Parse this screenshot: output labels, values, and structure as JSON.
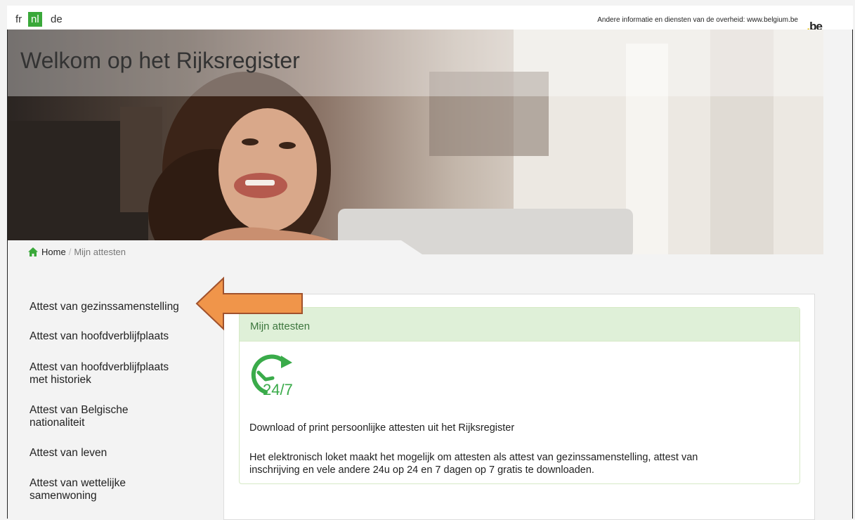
{
  "languages": [
    {
      "code": "fr",
      "active": false
    },
    {
      "code": "nl",
      "active": true
    },
    {
      "code": "de",
      "active": false
    }
  ],
  "header": {
    "other_info": "Andere informatie en diensten van de overheid: www.belgium.be",
    "logo_text": "be",
    "logo_dot": "."
  },
  "banner": {
    "title": "Welkom op het Rijksregister"
  },
  "breadcrumb": {
    "home": "Home",
    "current": "Mijn attesten"
  },
  "sidebar": {
    "items": [
      {
        "line1": "Attest van gezinssamenstelling",
        "line2": ""
      },
      {
        "line1": "Attest van hoofdverblijfplaats",
        "line2": ""
      },
      {
        "line1": "Attest van hoofdverblijfplaats",
        "line2": "met historiek"
      },
      {
        "line1": "Attest van Belgische",
        "line2": "nationaliteit"
      },
      {
        "line1": "Attest van leven",
        "line2": ""
      },
      {
        "line1": "Attest van wettelijke",
        "line2": "samenwoning"
      }
    ]
  },
  "panel": {
    "heading": "Mijn attesten",
    "icon_text": "24/7",
    "intro": "Download of print persoonlijke attesten uit het Rijksregister",
    "description_line1": "Het elektronisch loket maakt het mogelijk om attesten als attest van gezinssamenstelling, attest van",
    "description_line2": "inschrijving en vele andere 24u op 24 en 7 dagen op 7 gratis te downloaden."
  },
  "colors": {
    "active_lang": "#3aa83a",
    "panel_heading_bg": "#dff0d8",
    "panel_heading_text": "#3c763d",
    "arrow": "#f0954a",
    "icon_green": "#3aab4a"
  },
  "icons": [
    "home-icon",
    "clock-247-icon",
    "arrow-annotation"
  ]
}
